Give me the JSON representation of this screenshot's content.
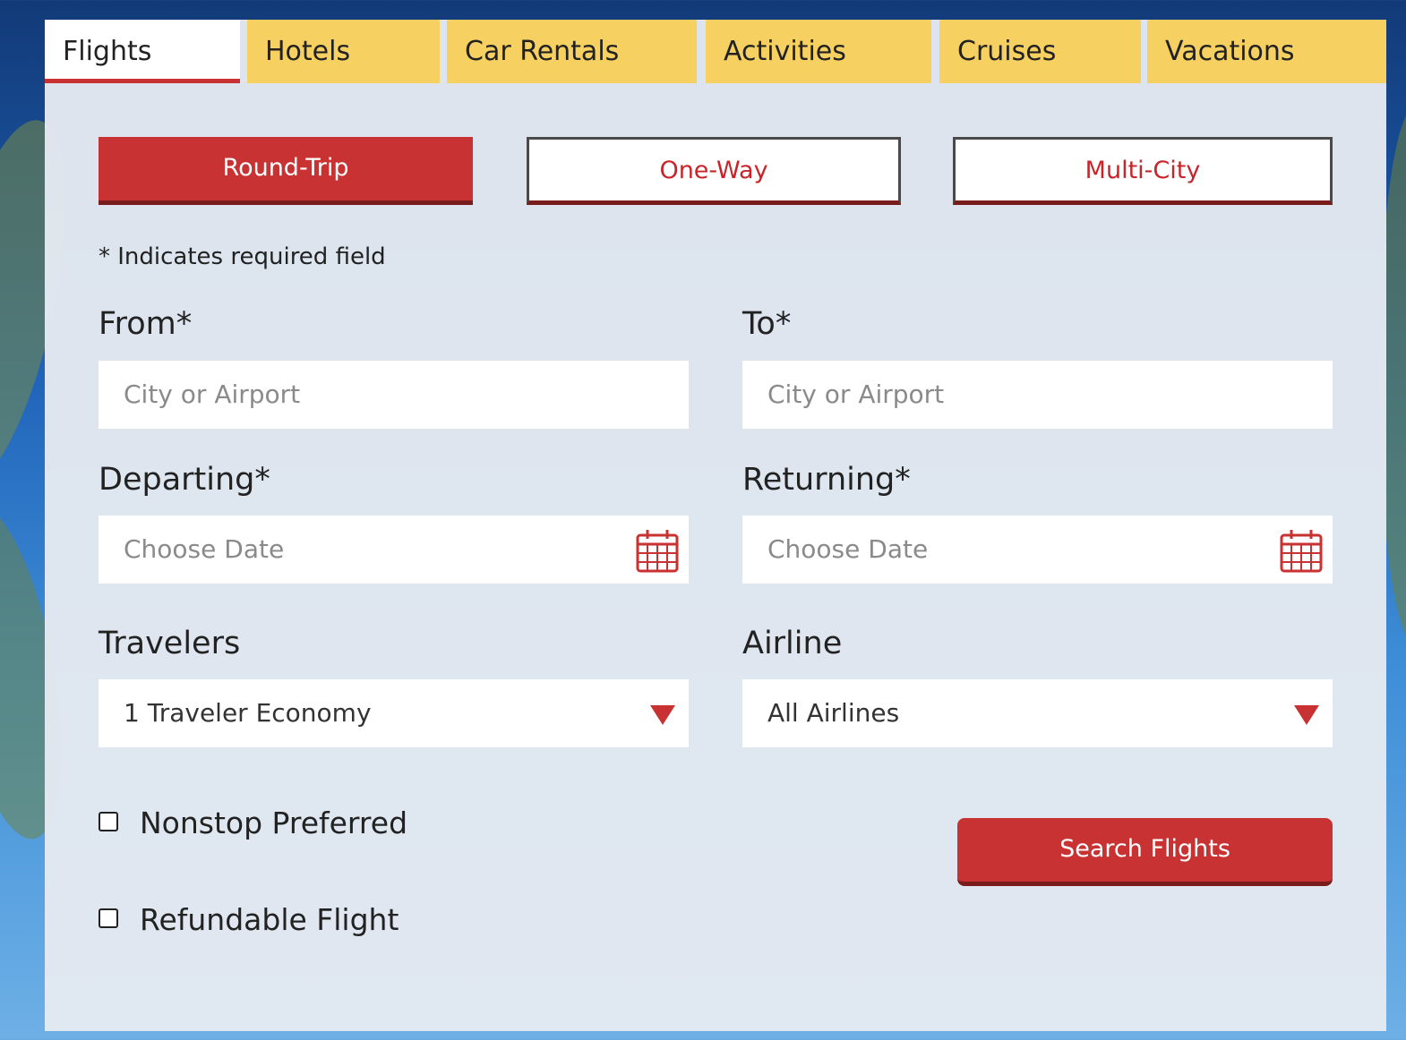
{
  "tabs": [
    {
      "label": "Flights",
      "active": true
    },
    {
      "label": "Hotels"
    },
    {
      "label": "Car Rentals"
    },
    {
      "label": "Activities"
    },
    {
      "label": "Cruises"
    },
    {
      "label": "Vacations"
    }
  ],
  "trip_types": {
    "round_trip": "Round-Trip",
    "one_way": "One-Way",
    "multi_city": "Multi-City",
    "selected": "Round-Trip"
  },
  "required_note": "* Indicates required field",
  "from": {
    "label": "From*",
    "placeholder": "City or Airport"
  },
  "to": {
    "label": "To*",
    "placeholder": "City or Airport"
  },
  "departing": {
    "label": "Departing*",
    "placeholder": "Choose Date",
    "icon": "calendar-icon"
  },
  "returning": {
    "label": "Returning*",
    "placeholder": "Choose Date",
    "icon": "calendar-icon"
  },
  "travelers": {
    "label": "Travelers",
    "value": "1 Traveler Economy"
  },
  "airline": {
    "label": "Airline",
    "value": "All Airlines"
  },
  "options": {
    "nonstop": {
      "label": "Nonstop Preferred",
      "checked": false
    },
    "refundable": {
      "label": "Refundable Flight",
      "checked": false
    }
  },
  "search_button": "Search Flights",
  "colors": {
    "accent": "#c83232",
    "tab_bg": "#f6d060",
    "panel_bg": "#e4e9f1"
  }
}
